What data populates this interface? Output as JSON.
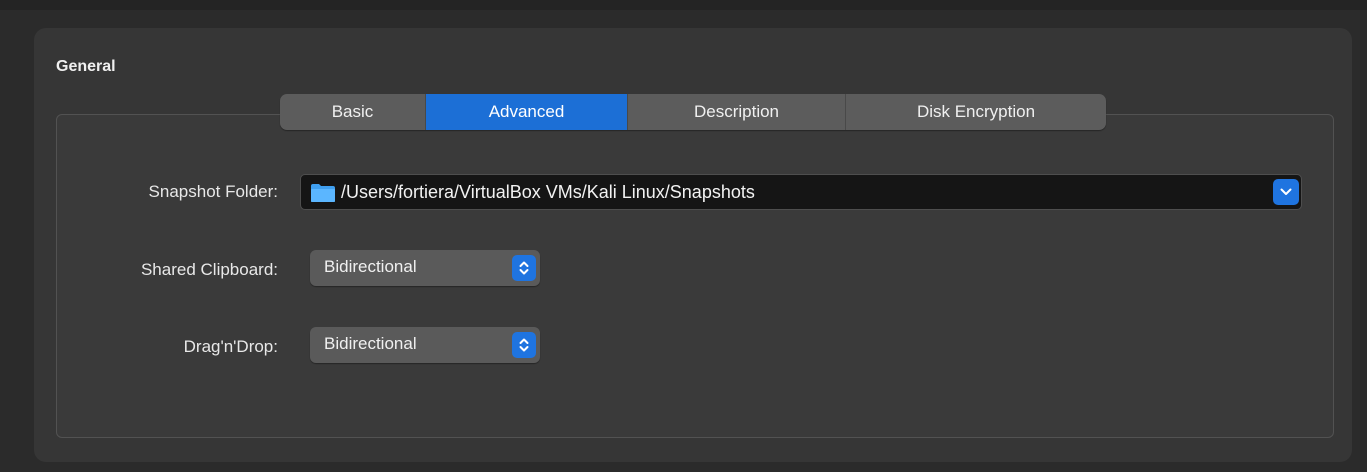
{
  "section": {
    "title": "General"
  },
  "tabs": [
    {
      "label": "Basic",
      "active": false
    },
    {
      "label": "Advanced",
      "active": true
    },
    {
      "label": "Description",
      "active": false
    },
    {
      "label": "Disk Encryption",
      "active": false
    }
  ],
  "snapshot_folder": {
    "label": "Snapshot Folder:",
    "value": "/Users/fortiera/VirtualBox VMs/Kali Linux/Snapshots",
    "icon": "folder-icon",
    "dropdown_icon": "chevron-down-icon"
  },
  "shared_clipboard": {
    "label": "Shared Clipboard:",
    "value": "Bidirectional",
    "icon": "up-down-chevron-icon"
  },
  "drag_n_drop": {
    "label": "Drag'n'Drop:",
    "value": "Bidirectional",
    "icon": "up-down-chevron-icon"
  },
  "colors": {
    "accent": "#1c6fd6",
    "panel": "#363636",
    "background": "#2b2b2b",
    "field": "#151515"
  }
}
